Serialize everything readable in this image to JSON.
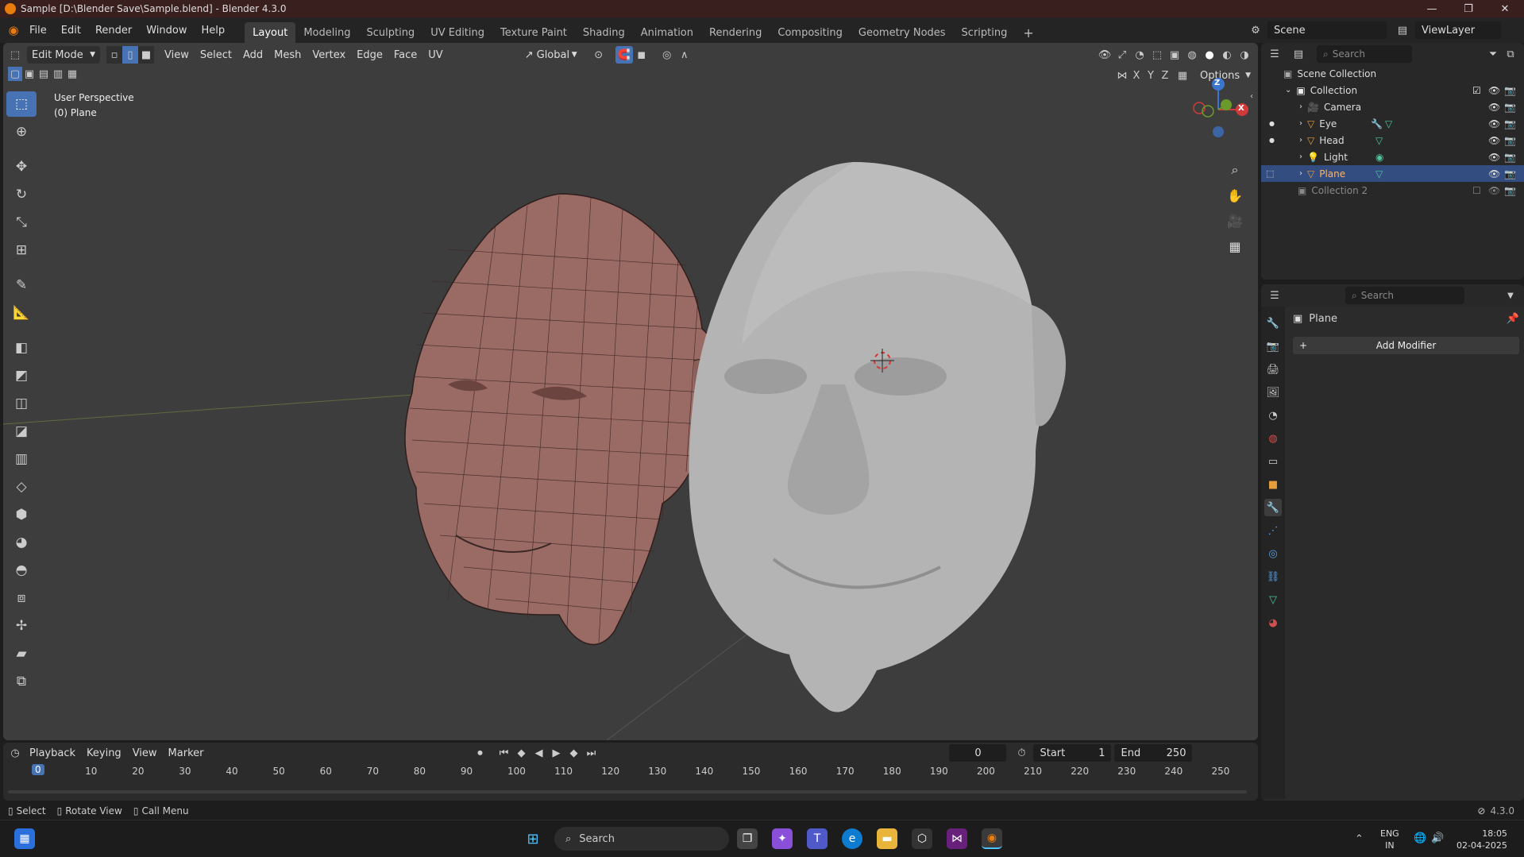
{
  "window": {
    "title": "Sample [D:\\Blender Save\\Sample.blend] - Blender 4.3.0",
    "controls": [
      "—",
      "❐",
      "✕"
    ]
  },
  "menus": [
    "File",
    "Edit",
    "Render",
    "Window",
    "Help"
  ],
  "workspaces": [
    "Layout",
    "Modeling",
    "Sculpting",
    "UV Editing",
    "Texture Paint",
    "Shading",
    "Animation",
    "Rendering",
    "Compositing",
    "Geometry Nodes",
    "Scripting"
  ],
  "scene_selector": {
    "scene": "Scene",
    "view_layer": "ViewLayer"
  },
  "viewport_header": {
    "mode": "Edit Mode",
    "menus": [
      "View",
      "Select",
      "Add",
      "Mesh",
      "Vertex",
      "Edge",
      "Face",
      "UV"
    ],
    "transform_orientation": "Global",
    "axes": [
      "X",
      "Y",
      "Z"
    ],
    "options_label": "Options"
  },
  "viewport_info": {
    "line1": "User Perspective",
    "line2": "(0) Plane"
  },
  "gizmo": {
    "z": "Z",
    "x": "X"
  },
  "outliner": {
    "search_placeholder": "Search",
    "scene_collection": "Scene Collection",
    "collection": "Collection",
    "items": [
      {
        "name": "Camera",
        "icon": "camera-icon"
      },
      {
        "name": "Eye",
        "icon": "mesh-icon"
      },
      {
        "name": "Head",
        "icon": "mesh-icon"
      },
      {
        "name": "Light",
        "icon": "light-icon"
      },
      {
        "name": "Plane",
        "icon": "mesh-icon",
        "selected": true
      }
    ],
    "collection2": "Collection 2"
  },
  "properties": {
    "search_placeholder": "Search",
    "object_name": "Plane",
    "add_modifier": "Add Modifier"
  },
  "timeline": {
    "menus": [
      "Playback",
      "Keying",
      "View",
      "Marker"
    ],
    "current_frame": "0",
    "start_label": "Start",
    "start": "1",
    "end_label": "End",
    "end": "250",
    "ruler": [
      "10",
      "20",
      "30",
      "40",
      "50",
      "60",
      "70",
      "80",
      "90",
      "100",
      "110",
      "120",
      "130",
      "140",
      "150",
      "160",
      "170",
      "180",
      "190",
      "200",
      "210",
      "220",
      "230",
      "240",
      "250"
    ],
    "playhead": "0"
  },
  "status": {
    "select": "Select",
    "rotate": "Rotate View",
    "menu": "Call Menu",
    "version": "4.3.0"
  },
  "taskbar": {
    "search": "Search",
    "lang1": "ENG",
    "lang2": "IN",
    "time": "18:05",
    "date": "02-04-2025"
  },
  "colors": {
    "accent": "#4772b3",
    "selected_row": "#334d80",
    "mesh_fill": "#9a6a64",
    "titlebar": "#3a1f1f"
  }
}
